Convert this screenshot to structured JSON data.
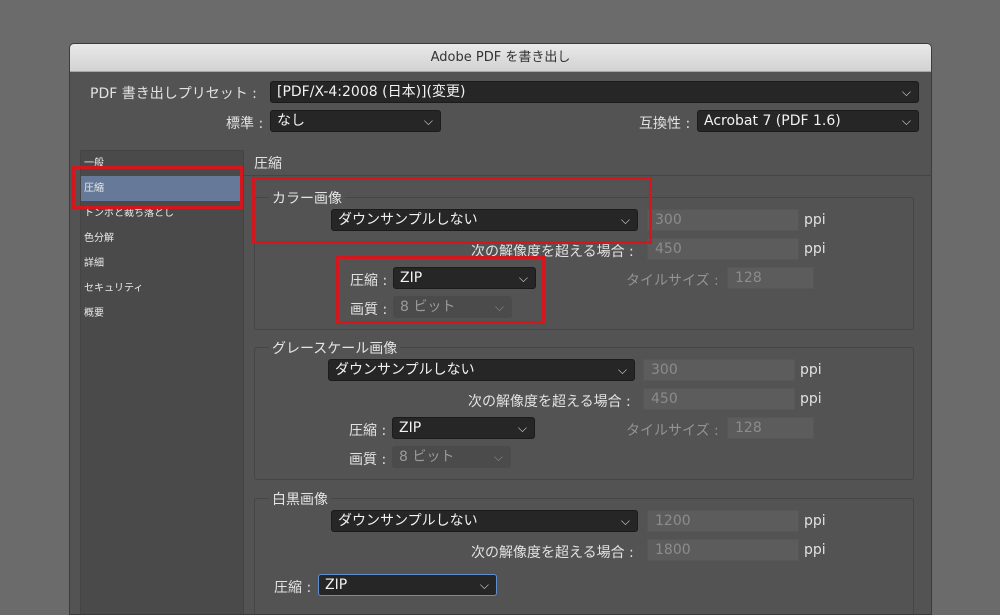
{
  "title": "Adobe PDF を書き出し",
  "preset": {
    "label": "PDF 書き出しプリセット :",
    "value": "[PDF/X-4:2008 (日本)](変更)"
  },
  "standard": {
    "label": "標準 :",
    "value": "なし"
  },
  "compat": {
    "label": "互換性 :",
    "value": "Acrobat 7 (PDF 1.6)"
  },
  "sidebar": {
    "items": [
      {
        "label": "一般"
      },
      {
        "label": "圧縮"
      },
      {
        "label": "トンボと裁ち落とし"
      },
      {
        "label": "色分解"
      },
      {
        "label": "詳細"
      },
      {
        "label": "セキュリティ"
      },
      {
        "label": "概要"
      }
    ]
  },
  "section_title": "圧縮",
  "color": {
    "title": "カラー画像",
    "downsample": "ダウンサンプルしない",
    "ppi_value": "300",
    "ppi_unit": "ppi",
    "above_label": "次の解像度を超える場合 :",
    "above_value": "450",
    "above_unit": "ppi",
    "compress_label": "圧縮 :",
    "compress_value": "ZIP",
    "tile_label": "タイルサイズ :",
    "tile_value": "128",
    "quality_label": "画質 :",
    "quality_value": "8 ビット"
  },
  "gray": {
    "title": "グレースケール画像",
    "downsample": "ダウンサンプルしない",
    "ppi_value": "300",
    "ppi_unit": "ppi",
    "above_label": "次の解像度を超える場合 :",
    "above_value": "450",
    "above_unit": "ppi",
    "compress_label": "圧縮 :",
    "compress_value": "ZIP",
    "tile_label": "タイルサイズ :",
    "tile_value": "128",
    "quality_label": "画質 :",
    "quality_value": "8 ビット"
  },
  "mono": {
    "title": "白黒画像",
    "downsample": "ダウンサンプルしない",
    "ppi_value": "1200",
    "ppi_unit": "ppi",
    "above_label": "次の解像度を超える場合 :",
    "above_value": "1800",
    "above_unit": "ppi",
    "compress_label": "圧縮 :",
    "compress_value": "ZIP"
  },
  "icons": {
    "dropdown": "chevron-down-icon"
  },
  "colors": {
    "highlight": "#d3171d",
    "sidebar_active": "#667999"
  }
}
